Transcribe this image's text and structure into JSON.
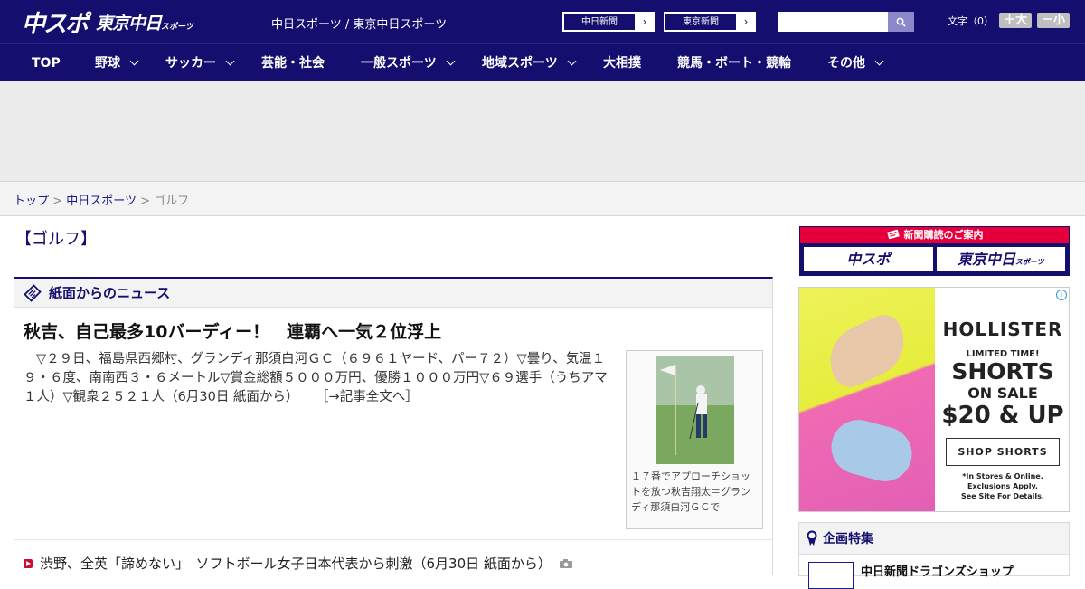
{
  "header": {
    "logo_main": "中スポ",
    "logo_sub": "東京中日",
    "logo_sub_small": "スポーツ",
    "site_links": "中日スポーツ / 東京中日スポーツ",
    "paper_buttons": [
      {
        "label": "中日新聞",
        "arrow": "›"
      },
      {
        "label": "東京新聞",
        "arrow": "›"
      }
    ],
    "search": {
      "value": "",
      "icon": "search-icon"
    },
    "font_size": {
      "label": "文字（0）",
      "bigger": "＋大",
      "smaller": "－小"
    }
  },
  "nav": [
    {
      "label": "TOP",
      "has_menu": false
    },
    {
      "label": "野球",
      "has_menu": true
    },
    {
      "label": "サッカー",
      "has_menu": true
    },
    {
      "label": "芸能・社会",
      "has_menu": false
    },
    {
      "label": "一般スポーツ",
      "has_menu": true
    },
    {
      "label": "地域スポーツ",
      "has_menu": true
    },
    {
      "label": "大相撲",
      "has_menu": false
    },
    {
      "label": "競馬・ボート・競輪",
      "has_menu": false
    },
    {
      "label": "その他",
      "has_menu": true
    }
  ],
  "breadcrumb": {
    "items": [
      "トップ",
      "中日スポーツ"
    ],
    "separator": ">",
    "current": "ゴルフ"
  },
  "category_title": "【ゴルフ】",
  "news": {
    "section_title": "紙面からのニュース",
    "headline": "秋吉、自己最多10バーディー！　連覇へ一気２位浮上",
    "summary": "▽２９日、福島県西郷村、グランディ那須白河ＧＣ（６９６１ヤード、パー７２）▽曇り、気温１９・６度、南南西３・６メートル▽賞金総額５０００万円、優勝１０００万円▽６９選手（うちアマ１人）▽観衆２５２１人（6月30日 紙面から）",
    "read_more": "［→記事全文へ］",
    "photo_caption": "１７番でアプローチショットを放つ秋吉翔太＝グランディ那須白河ＧＣで",
    "items": [
      {
        "text": "渋野、全英「諦めない」　ソフトボール女子日本代表から刺激（6月30日 紙面から）",
        "has_photo": true
      }
    ]
  },
  "sidebar": {
    "subscription": {
      "title": "新聞購読のご案内",
      "logo1": "中スポ",
      "logo2": "東京中日",
      "logo2_small": "スポーツ"
    },
    "ad": {
      "brand": "HOLLISTER",
      "line1": "LIMITED TIME!",
      "line2": "SHORTS",
      "line3": "ON SALE",
      "line4": "$20 & UP",
      "button": "SHOP SHORTS",
      "fine_print": "*In Stores & Online.\nExclusions Apply.\nSee Site For Details.",
      "info": "i"
    },
    "feature": {
      "title": "企画特集",
      "item": "中日新聞ドラゴンズショップ"
    }
  }
}
